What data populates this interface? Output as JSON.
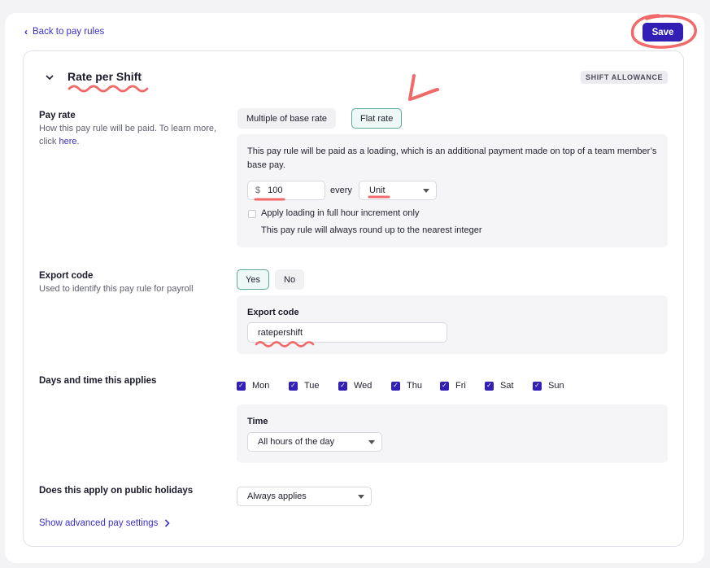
{
  "header": {
    "back_label": "Back to pay rules",
    "save_label": "Save"
  },
  "rule": {
    "title": "Rate per Shift",
    "badge": "SHIFT ALLOWANCE"
  },
  "pay_rate": {
    "title": "Pay rate",
    "desc_prefix": "How this pay rule will be paid. To learn more, click ",
    "desc_link": "here",
    "desc_suffix": ".",
    "options": [
      "Multiple of base rate",
      "Flat rate"
    ],
    "selected": "Flat rate",
    "info": "This pay rule will be paid as a loading, which is an additional payment made on top of a team member’s base pay.",
    "currency": "$",
    "amount": "100",
    "every_label": "every",
    "unit": "Unit",
    "increment_label": "Apply loading in full hour increment only",
    "increment_checked": false,
    "round_note": "This pay rule will always round up to the nearest integer"
  },
  "export": {
    "title": "Export code",
    "desc": "Used to identify this pay rule for payroll",
    "options": [
      "Yes",
      "No"
    ],
    "selected": "Yes",
    "field_label": "Export code",
    "value": "ratepershift"
  },
  "days": {
    "title": "Days and time this applies",
    "items": [
      {
        "label": "Mon",
        "checked": true
      },
      {
        "label": "Tue",
        "checked": true
      },
      {
        "label": "Wed",
        "checked": true
      },
      {
        "label": "Thu",
        "checked": true
      },
      {
        "label": "Fri",
        "checked": true
      },
      {
        "label": "Sat",
        "checked": true
      },
      {
        "label": "Sun",
        "checked": true
      }
    ],
    "time_label": "Time",
    "time_value": "All hours of the day"
  },
  "holidays": {
    "title": "Does this apply on public holidays",
    "value": "Always applies"
  },
  "advanced_label": "Show advanced pay settings",
  "colors": {
    "accent": "#3220b5",
    "link": "#3b2fc9",
    "annotation": "#f06a6a",
    "selected_border": "#5ea999"
  }
}
